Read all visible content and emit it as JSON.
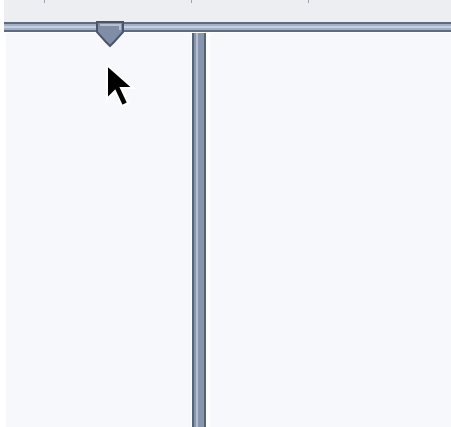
{
  "window": {
    "description_label": ""
  },
  "ruler": {
    "tick_count": 3,
    "marker": {
      "icon": "indent-marker-icon"
    }
  },
  "columns": {
    "count": 2,
    "divider_icon": "column-divider"
  },
  "pointer": {
    "icon": "mouse-pointer-icon"
  },
  "colors": {
    "ruler_background": "#eceef2",
    "ruler_bar": "#a3b1c6",
    "ruler_border": "#5d6b80",
    "page_background": "#f7f8fb",
    "divider": "#8896ad",
    "marker": "#7f8da5"
  }
}
